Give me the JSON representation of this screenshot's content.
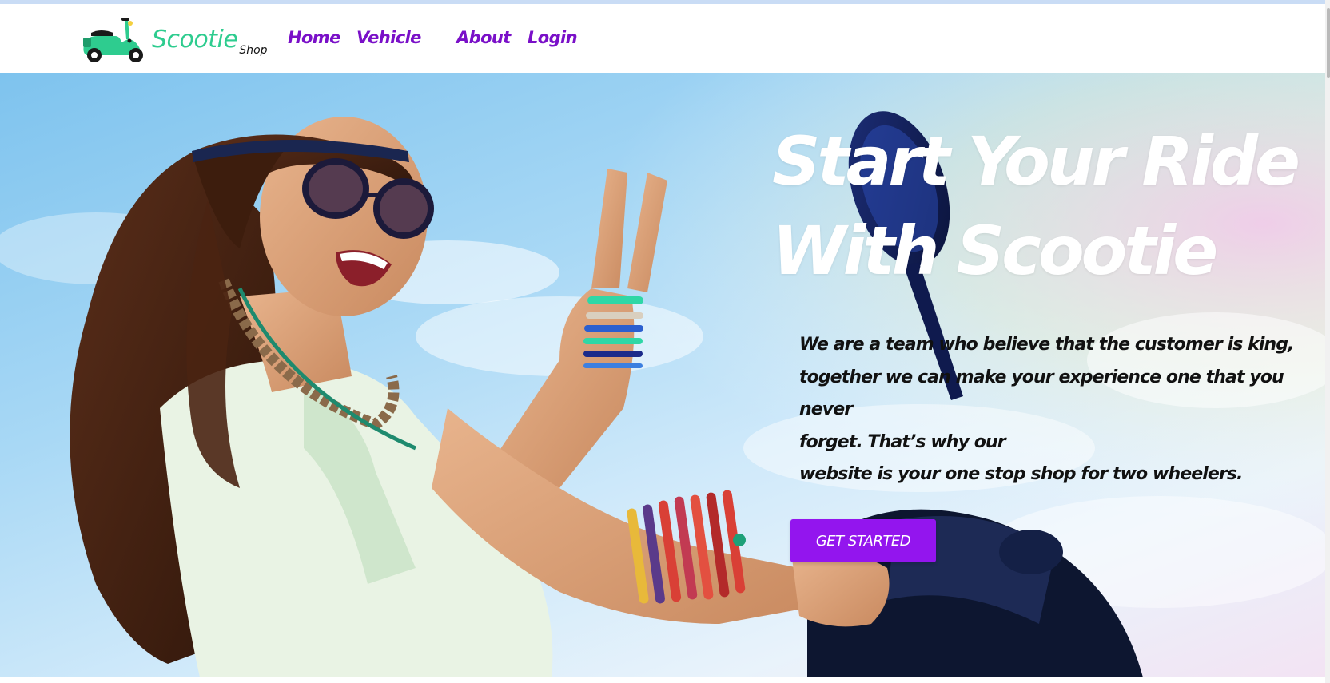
{
  "brand": {
    "name": "Scootie",
    "suffix": "Shop",
    "logo_icon": "scooter-icon",
    "name_color": "#2ecc8f"
  },
  "nav": {
    "items": [
      {
        "label": "Home"
      },
      {
        "label": "Vehicle"
      },
      {
        "label": "About"
      },
      {
        "label": "Login"
      }
    ],
    "link_color": "#7a10c8"
  },
  "hero": {
    "title_line1": "Start Your Ride",
    "title_line2": "With Scootie",
    "paragraph_lines": [
      "We are a team who believe that the customer is king,",
      "together we can make your experience one that you",
      "never",
      "forget. That’s why our",
      "website is your one stop shop for two wheelers."
    ],
    "cta_label": "GET STARTED",
    "cta_color": "#9315ee"
  }
}
